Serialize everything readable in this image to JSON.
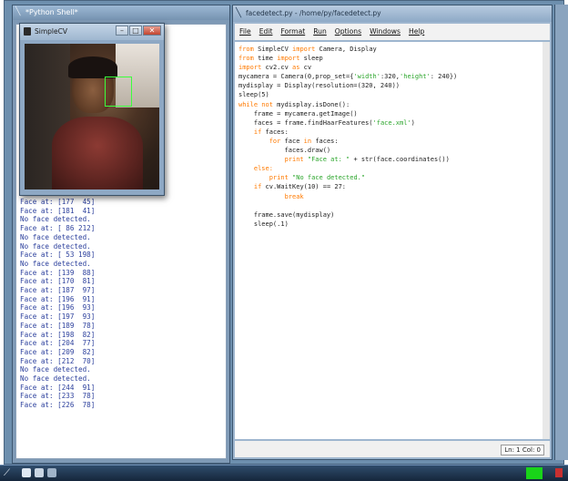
{
  "python_shell": {
    "title": "*Python Shell*",
    "output_lines": [
      "Face at: [177  45]",
      "Face at: [181  41]",
      "No face detected.",
      "Face at: [ 86 212]",
      "No face detected.",
      "No face detected.",
      "Face at: [ 53 198]",
      "No face detected.",
      "Face at: [139  88]",
      "Face at: [170  81]",
      "Face at: [187  97]",
      "Face at: [196  91]",
      "Face at: [196  93]",
      "Face at: [197  93]",
      "Face at: [189  78]",
      "Face at: [198  82]",
      "Face at: [204  77]",
      "Face at: [209  82]",
      "Face at: [212  70]",
      "No face detected.",
      "No face detected.",
      "Face at: [244  91]",
      "Face at: [233  78]",
      "Face at: [226  78]"
    ]
  },
  "simplecv": {
    "title": "SimpleCV"
  },
  "editor": {
    "title": "facedetect.py - /home/py/facedetect.py",
    "menu": [
      "File",
      "Edit",
      "Format",
      "Run",
      "Options",
      "Windows",
      "Help"
    ],
    "code": [
      [
        [
          "kw",
          "from"
        ],
        [
          "n",
          " SimpleCV "
        ],
        [
          "kw",
          "import"
        ],
        [
          "n",
          " Camera, Display"
        ]
      ],
      [
        [
          "kw",
          "from"
        ],
        [
          "n",
          " time "
        ],
        [
          "kw",
          "import"
        ],
        [
          "n",
          " sleep"
        ]
      ],
      [
        [
          "kw",
          "import"
        ],
        [
          "n",
          " cv2.cv "
        ],
        [
          "kw",
          "as"
        ],
        [
          "n",
          " cv"
        ]
      ],
      [
        [
          "n",
          "mycamera = Camera(0,prop_set={"
        ],
        [
          "str",
          "'width'"
        ],
        [
          "n",
          ":320,"
        ],
        [
          "str",
          "'height'"
        ],
        [
          "n",
          ": 240})"
        ]
      ],
      [
        [
          "n",
          "mydisplay = Display(resolution=(320, 240))"
        ]
      ],
      [
        [
          "n",
          "sleep(5)"
        ]
      ],
      [
        [
          "kw",
          "while not"
        ],
        [
          "n",
          " mydisplay.isDone():"
        ]
      ],
      [
        [
          "n",
          "    frame = mycamera.getImage()"
        ]
      ],
      [
        [
          "n",
          "    faces = frame.findHaarFeatures("
        ],
        [
          "str",
          "'face.xml'"
        ],
        [
          "n",
          ")"
        ]
      ],
      [
        [
          "n",
          "    "
        ],
        [
          "kw",
          "if"
        ],
        [
          "n",
          " faces:"
        ]
      ],
      [
        [
          "n",
          "        "
        ],
        [
          "kw",
          "for"
        ],
        [
          "n",
          " face "
        ],
        [
          "kw",
          "in"
        ],
        [
          "n",
          " faces:"
        ]
      ],
      [
        [
          "n",
          "            faces.draw()"
        ]
      ],
      [
        [
          "n",
          "            "
        ],
        [
          "kw",
          "print"
        ],
        [
          "n",
          " "
        ],
        [
          "str",
          "\"Face at: \""
        ],
        [
          "n",
          " + str(face.coordinates())"
        ]
      ],
      [
        [
          "n",
          "    "
        ],
        [
          "kw",
          "else:"
        ]
      ],
      [
        [
          "n",
          "        "
        ],
        [
          "kw",
          "print"
        ],
        [
          "n",
          " "
        ],
        [
          "str",
          "\"No face detected.\""
        ]
      ],
      [
        [
          "n",
          "    "
        ],
        [
          "kw",
          "if"
        ],
        [
          "n",
          " cv.WaitKey(10) == 27:"
        ]
      ],
      [
        [
          "n",
          "            "
        ],
        [
          "kw",
          "break"
        ]
      ],
      [
        [
          "n",
          ""
        ]
      ],
      [
        [
          "n",
          "    frame.save(mydisplay)"
        ]
      ],
      [
        [
          "n",
          "    sleep(.1)"
        ]
      ]
    ],
    "status": "Ln: 1 Col: 0"
  },
  "taskbar": {
    "start_glyph": "╱\\",
    "colors": {
      "tray_indicator": "#19d419"
    }
  }
}
